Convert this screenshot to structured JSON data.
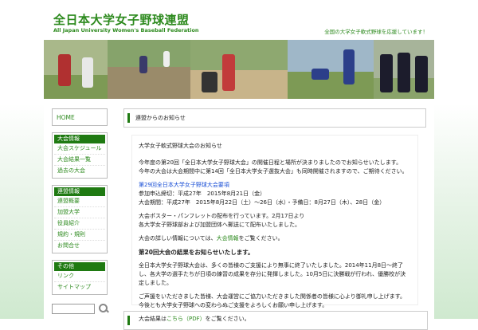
{
  "header": {
    "title": "全日本大学女子野球連盟",
    "subtitle": "All Japan University Women's Baseball Federation",
    "tagline": "全国の大学女子軟式野球を応援しています！"
  },
  "sidebar": {
    "home": "HOME",
    "menus": [
      {
        "heading": "大会情報",
        "items": [
          "大会スケジュール",
          "大会結果一覧",
          "過去の大会"
        ]
      },
      {
        "heading": "連盟情報",
        "items": [
          "連盟概要",
          "加盟大学",
          "役員紹介",
          "規約・規則",
          "お問合せ"
        ]
      },
      {
        "heading": "その他",
        "items": [
          "リンク",
          "サイトマップ"
        ]
      }
    ],
    "search": {
      "placeholder": ""
    }
  },
  "main": {
    "heading": "連盟からのお知らせ",
    "lead": "大学女子軟式野球大会のお知らせ",
    "para1_line1": "今年度の第20回「全日本大学女子野球大会」の開催日程と場所が決まりましたのでお知らせいたします。",
    "para1_line2": "今年の大会は大会期間中に第14回「全日本大学女子選抜大会」も同時開催されますので、ご期待ください。",
    "link1": "第29回全日本大学女子野球大会要項",
    "date1": "参加申込締切：平成27年　2015年8月21日（金）",
    "date2": "大会期間：平成27年　2015年8月22日（土）〜26日（水）・予備日：8月27日（木）、28日（金）",
    "para3_line1": "大会ポスター・パンフレットの配布を行っています。2月17日より",
    "para3_line2": "各大学女子野球部および加盟団体へ郵送にて配布いたしました。",
    "para4_pre": "大会の詳しい情報については、",
    "para4_link": "大会情報",
    "para4_post": "をご覧ください。",
    "bold_prefix": "第",
    "bold_num": "20",
    "bold_rest": "回大会の結果をお知らせいたします。",
    "para5": "全日本大学女子野球大会は、多くの皆様のご支援により無事に終了いたしました。2014年11月8日〜終了し、各大学の選手たちが日頃の練習の成果を存分に発揮しました。10月5日に決勝戦が行われ、優勝校が決定しました。",
    "para6": "ご声援をいただきました皆様、大会運営にご協力いただきました関係者の皆様に心より御礼申し上げます。今後とも大学女子野球への変わらぬご支援をよろしくお願い申し上げます。",
    "para7_pre": "大会結果は",
    "para7_link": "こちら（PDF）",
    "para7_post": "をご覧ください。"
  },
  "colors": {
    "accent": "#1f7a12",
    "link": "#1a4fd6",
    "text_green": "#2d8a1e"
  }
}
